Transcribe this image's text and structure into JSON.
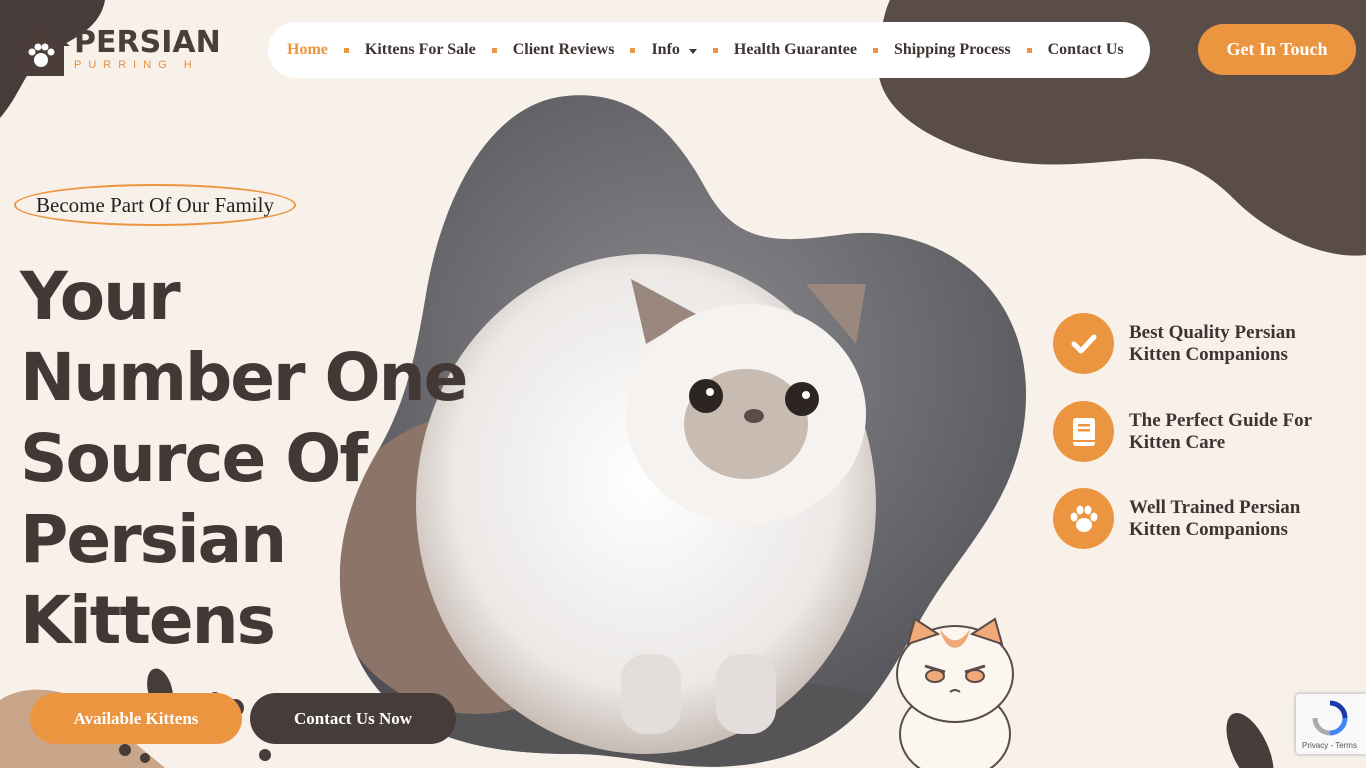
{
  "brand": {
    "name": "PERSIAN",
    "subtitle": "PURRING H"
  },
  "nav": {
    "items": [
      {
        "label": "Home",
        "active": true
      },
      {
        "label": "Kittens For Sale"
      },
      {
        "label": "Client Reviews"
      },
      {
        "label": "Info",
        "has_dropdown": true
      },
      {
        "label": "Health Guarantee"
      },
      {
        "label": "Shipping Process"
      },
      {
        "label": "Contact Us"
      }
    ],
    "cta": "Get In Touch"
  },
  "hero": {
    "tagline": "Become Part Of Our Family",
    "headline_lines": [
      "Your",
      "Number One",
      "Source Of",
      "Persian",
      "Kittens"
    ],
    "primary_button": "Available Kittens",
    "secondary_button": "Contact Us Now"
  },
  "features": [
    {
      "icon": "check-icon",
      "text": "Best Quality Persian Kitten Companions"
    },
    {
      "icon": "book-icon",
      "text": "The Perfect Guide For Kitten Care"
    },
    {
      "icon": "paw-icon",
      "text": "Well Trained Persian Kitten Companions"
    }
  ],
  "recaptcha": {
    "text": "Privacy - Terms"
  },
  "colors": {
    "accent": "#ec9540",
    "dark": "#463c3a",
    "background": "#f8f1ea"
  }
}
